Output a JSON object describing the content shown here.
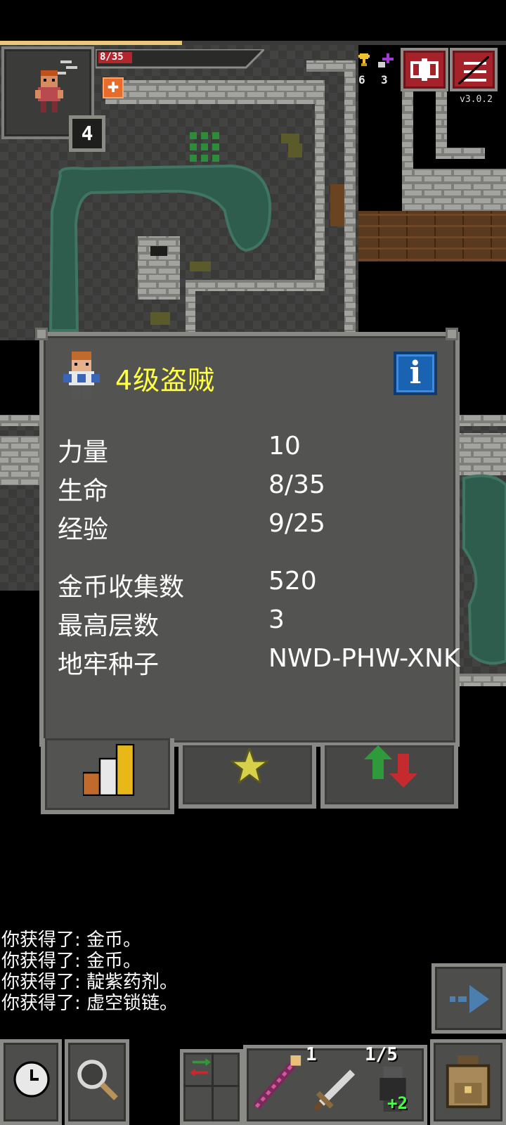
{
  "status": {
    "hp_text": "8/35",
    "hp_fraction": 0.229,
    "xp_fraction": 0.36,
    "level": "4",
    "gold_count": "6",
    "key_count": "3",
    "version": "v3.0.2"
  },
  "icons": {
    "hero": "rogue-hero-icon",
    "buff": "buff-icon",
    "journal": "journal-icon",
    "menu": "menu-icon",
    "info": "info-icon",
    "stats_tab": "stats-bars-icon",
    "badges_tab": "star-icon",
    "changes_tab": "up-down-arrows-icon",
    "wait": "clock-icon",
    "search": "magnifier-icon",
    "swap": "swap-arrows-icon",
    "wand": "wand-icon",
    "dagger": "dagger-icon",
    "chains": "chains-icon",
    "backpack": "backpack-icon",
    "resume": "resume-arrow-icon"
  },
  "colors": {
    "title_yellow": "#ffff44",
    "hp_red": "#b3262e",
    "xp_gold": "#e9c877",
    "info_blue": "#1a63b3"
  },
  "window": {
    "title": "4级盗贼",
    "stats": [
      {
        "label": "力量",
        "value": "10"
      },
      {
        "label": "生命",
        "value": "8/35"
      },
      {
        "label": "经验",
        "value": "9/25"
      }
    ],
    "stats2": [
      {
        "label": "金币收集数",
        "value": "520"
      },
      {
        "label": "最高层数",
        "value": "3"
      },
      {
        "label": "地牢种子",
        "value": "NWD-PHW-XNK"
      }
    ]
  },
  "log": [
    "你获得了: 金币。",
    "你获得了: 金币。",
    "你获得了: 靛紫药剂。",
    "你获得了: 虚空锁链。"
  ],
  "quickslots": {
    "dagger_count": "1",
    "chains_charge": "1/5",
    "chains_bonus": "+2"
  }
}
